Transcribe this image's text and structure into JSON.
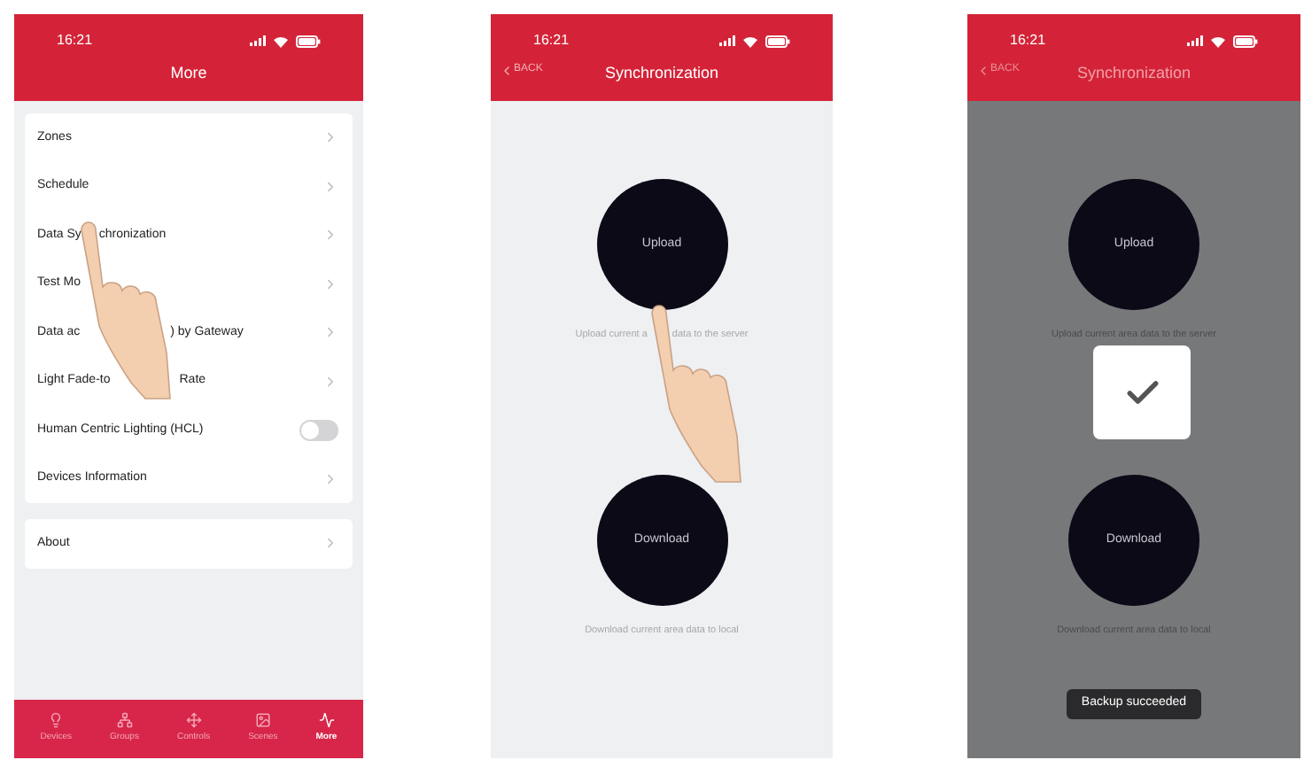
{
  "screens": [
    {
      "kind": "menu",
      "time": "16:21",
      "title": "More",
      "hand": true,
      "groups": [
        [
          {
            "kind": "link",
            "parts": [
              "Zones"
            ]
          },
          {
            "kind": "link",
            "parts": [
              "Schedule"
            ]
          },
          {
            "kind": "link",
            "parts": [
              "Data Sy",
              "chronization"
            ]
          },
          {
            "kind": "link",
            "parts": [
              "Test Mo"
            ]
          },
          {
            "kind": "link",
            "parts": [
              "Data ac",
              ") by Gateway"
            ]
          },
          {
            "kind": "link",
            "parts": [
              "Light Fade-to",
              "Rate"
            ]
          },
          {
            "kind": "toggle",
            "parts": [
              "Human Centric Lighting (HCL)"
            ],
            "on": false
          },
          {
            "kind": "link",
            "parts": [
              "Devices Information"
            ]
          }
        ],
        [
          {
            "kind": "link",
            "parts": [
              "About"
            ]
          }
        ]
      ],
      "tabs": [
        {
          "label": "Devices",
          "selected": false
        },
        {
          "label": "Groups",
          "selected": false
        },
        {
          "label": "Controls",
          "selected": false
        },
        {
          "label": "Scenes",
          "selected": false
        },
        {
          "label": "More",
          "selected": true
        }
      ]
    },
    {
      "kind": "sync",
      "time": "16:21",
      "title": "Synchronization",
      "back": "BACK",
      "hand": true,
      "dimmed": false,
      "upload": {
        "label": "Upload",
        "hint_parts": [
          "Upload current a",
          "data to the server"
        ]
      },
      "download": {
        "label": "Download",
        "hint_parts": [
          "Download current area data to local"
        ]
      }
    },
    {
      "kind": "sync",
      "time": "16:21",
      "title": "Synchronization",
      "back": "BACK",
      "dimmed": true,
      "upload": {
        "label": "Upload",
        "hint_parts": [
          "Upload current area data to the server"
        ]
      },
      "download": {
        "label": "Download",
        "hint_parts": [
          "Download current area data to local"
        ]
      },
      "success_dialog": true,
      "toast": "Backup succeeded"
    }
  ]
}
